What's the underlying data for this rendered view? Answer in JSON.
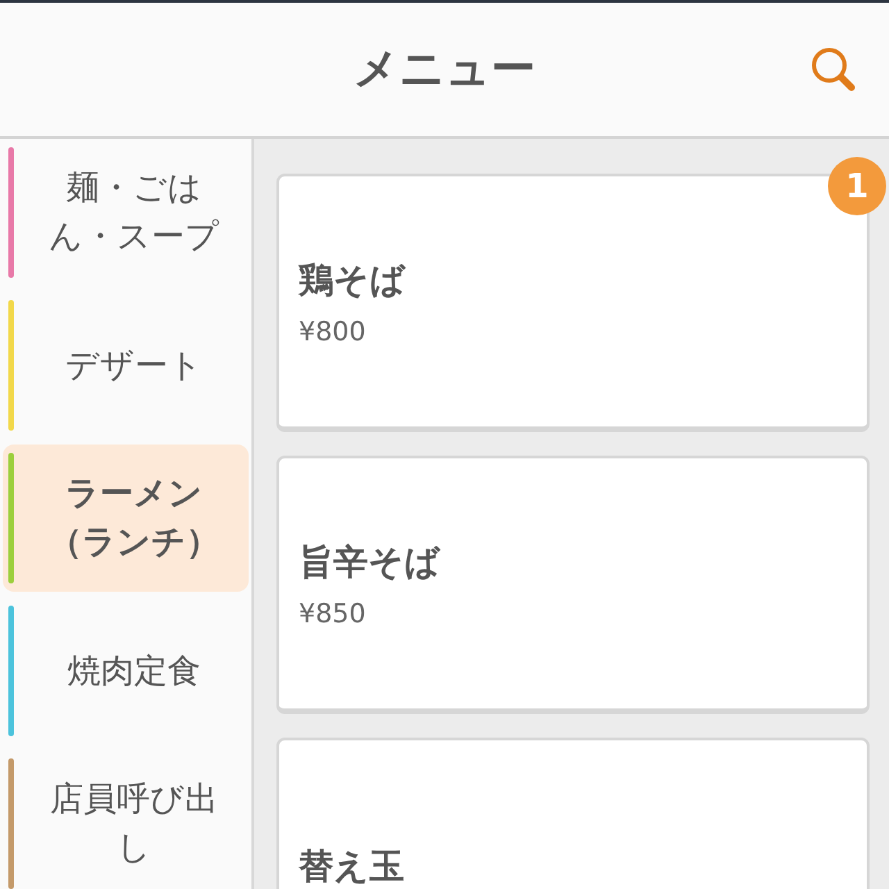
{
  "header": {
    "title": "メニュー"
  },
  "categories": [
    {
      "label": "麺・ごはん・スープ",
      "color": "#e879a8",
      "selected": false
    },
    {
      "label": "デザート",
      "color": "#f2d84a",
      "selected": false
    },
    {
      "label": "ラーメン（ランチ）",
      "color": "#9ccf3c",
      "selected": true
    },
    {
      "label": "焼肉定食",
      "color": "#4cc3dc",
      "selected": false
    },
    {
      "label": "店員呼び出し",
      "color": "#c49a6a",
      "selected": false
    }
  ],
  "items": [
    {
      "name": "鶏そば",
      "price": "¥800",
      "count": "1"
    },
    {
      "name": "旨辛そば",
      "price": "¥850"
    },
    {
      "name": "替え玉"
    }
  ]
}
